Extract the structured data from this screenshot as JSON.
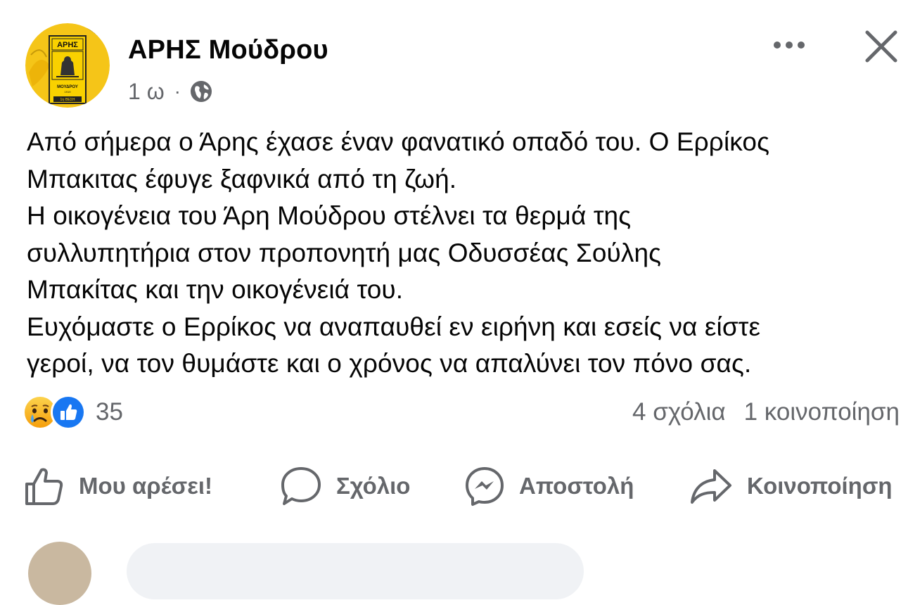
{
  "post": {
    "page_name": "ΑΡΗΣ Μούδρου",
    "time": "1 ω",
    "separator": "·",
    "privacy_icon": "globe-icon",
    "more_icon": "more-horizontal-icon",
    "close_icon": "close-icon",
    "avatar": {
      "top_text": "ΑΡΗΣ",
      "bottom_text": "ΜΟΥΔΡΟΥ",
      "band_text": "1η ΘΕΣΗ",
      "side_text": "Ναυτικό Σωματείο",
      "bg_color": "#f5c518"
    },
    "text_lines": [
      "Από σήμερα ο Άρης έχασε έναν φανατικό οπαδό του. Ο Ερρίκος",
      "Μπακιτας έφυγε ξαφνικά από τη ζωή.",
      "Η οικογένεια του Άρη Μούδρου στέλνει τα θερμά της",
      "συλλυπητήρια στον προπονητή μας Οδυσσέας Σούλης",
      "Μπακίτας και την οικογένειά του.",
      "Ευχόμαστε ο Ερρίκος να αναπαυθεί εν ειρήνη και εσείς να είστε",
      "γεροί, να τον θυμάστε και ο χρόνος να απαλύνει τον πόνο σας."
    ]
  },
  "reactions": {
    "icons": [
      "crying-face-icon",
      "like-reaction-icon"
    ],
    "count": "35",
    "comments": "4 σχόλια",
    "shares": "1 κοινοποίηση"
  },
  "actions": {
    "like": "Μου αρέσει!",
    "comment": "Σχόλιο",
    "send": "Αποστολή",
    "share": "Κοινοποίηση"
  },
  "colors": {
    "text": "#050505",
    "secondary": "#65676b",
    "like_blue": "#1877f2",
    "sad_yellow": "#f7b928"
  }
}
